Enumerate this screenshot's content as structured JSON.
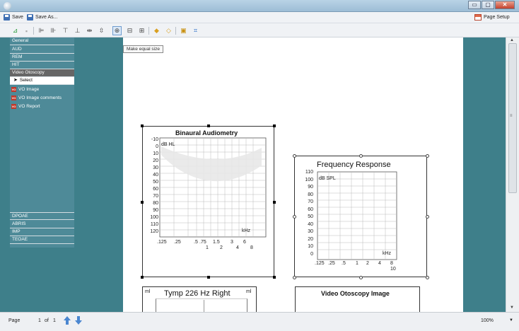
{
  "window": {
    "controls": {
      "minimize": "▭",
      "maximize": "▢",
      "close": "✕"
    }
  },
  "menubar": {
    "save_label": "Save",
    "save_as_label": "Save As...",
    "page_setup_label": "Page Setup"
  },
  "toolbar": {
    "tooltip": "Make equal size",
    "icons": [
      "align-icon",
      "align-left-icon",
      "align-center-icon",
      "align-top-icon",
      "align-bottom-icon",
      "space-horizontal-icon",
      "space-vertical-icon",
      "make-equal-size-icon",
      "bring-front-icon",
      "send-back-icon",
      "group-icon",
      "ungroup-icon",
      "image-icon",
      "crop-icon"
    ]
  },
  "nav": {
    "top_items": [
      "General",
      "AUD",
      "REM",
      "HIT",
      "Video Otoscopy"
    ],
    "select_label": "Select",
    "vo_badge": "VO",
    "vo_items": [
      "VO Image",
      "VO Image comments",
      "VO Report"
    ],
    "bottom_items": [
      "DPOAE",
      "ABRIS",
      "IMP",
      "TEOAE"
    ]
  },
  "cards": {
    "binaural": {
      "title": "Binaural Audiometry",
      "unit": "dB HL",
      "yticks": [
        "-10",
        "0",
        "10",
        "20",
        "30",
        "40",
        "50",
        "60",
        "70",
        "80",
        "90",
        "100",
        "110",
        "120"
      ],
      "xunit": "kHz",
      "xticks_top": [
        ".125",
        ".25",
        ".5",
        ".75",
        "1.5",
        "3",
        "6"
      ],
      "xticks_bottom": [
        "1",
        "2",
        "4",
        "8"
      ]
    },
    "frequency": {
      "title": "Frequency Response",
      "unit": "dB SPL",
      "yticks": [
        "110",
        "100",
        "90",
        "80",
        "70",
        "60",
        "50",
        "40",
        "30",
        "20",
        "10",
        "0"
      ],
      "xunit": "kHz",
      "xticks": [
        ".125",
        ".25",
        ".5",
        "1",
        "2",
        "4",
        "8"
      ],
      "xtick_extra": "10"
    },
    "tymp": {
      "title": "Tymp 226 Hz Right",
      "unit_left": "ml",
      "unit_right": "ml"
    },
    "video": {
      "title": "Video Otoscopy Image"
    }
  },
  "statusbar": {
    "page_label": "Page",
    "page_current": "1",
    "of_label": "of",
    "page_total": "1",
    "zoom": "100%"
  }
}
